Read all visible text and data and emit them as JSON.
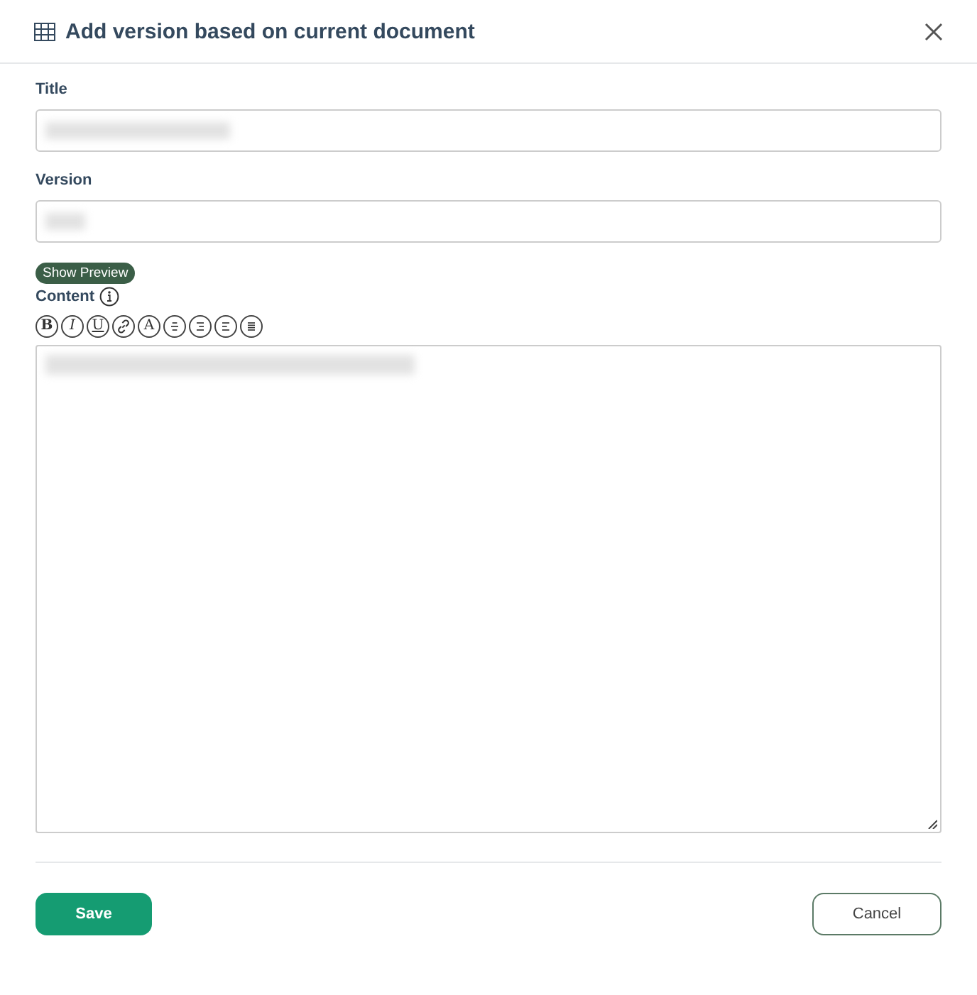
{
  "dialog": {
    "title": "Add version based on current document"
  },
  "fields": [
    {
      "label": "Title"
    },
    {
      "label": "Version"
    }
  ],
  "preview_button": "Show Preview",
  "content": {
    "label": "Content"
  },
  "toolbar": [
    {
      "kind": "bold",
      "text": "B"
    },
    {
      "kind": "italic",
      "text": "I"
    },
    {
      "kind": "underline",
      "text": "U"
    },
    {
      "kind": "link"
    },
    {
      "kind": "plain",
      "text": "A"
    },
    {
      "kind": "align-center"
    },
    {
      "kind": "align-right"
    },
    {
      "kind": "align-left"
    },
    {
      "kind": "align-justify"
    }
  ],
  "buttons": {
    "save": "Save",
    "cancel": "Cancel"
  }
}
